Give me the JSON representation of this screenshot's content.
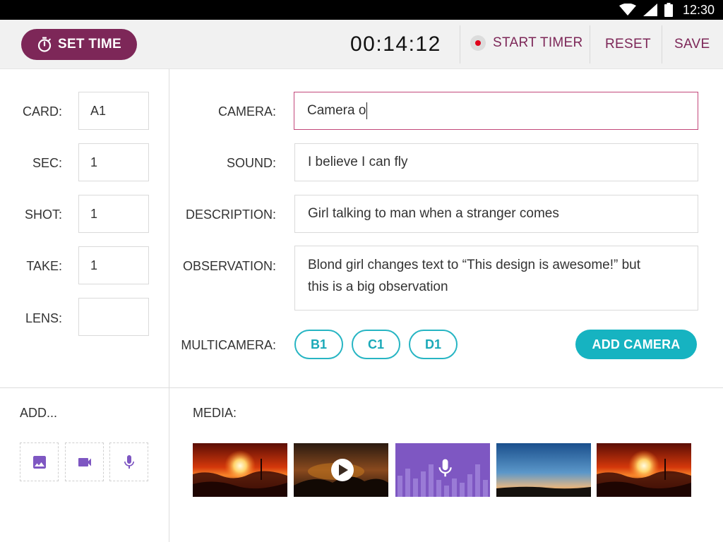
{
  "status_bar": {
    "time": "12:30"
  },
  "toolbar": {
    "set_time_label": "SET TIME",
    "timer": "00:14:12",
    "start_timer_label": "START TIMER",
    "reset_label": "RESET",
    "save_label": "SAVE"
  },
  "left_form": {
    "card_label": "CARD:",
    "card_value": "A1",
    "sec_label": "SEC:",
    "sec_value": "1",
    "shot_label": "SHOT:",
    "shot_value": "1",
    "take_label": "TAKE:",
    "take_value": "1",
    "lens_label": "LENS:",
    "lens_value": ""
  },
  "right_form": {
    "camera_label": "CAMERA:",
    "camera_value": "Camera o",
    "sound_label": "SOUND:",
    "sound_value": "I believe I can fly",
    "description_label": "DESCRIPTION:",
    "description_value": "Girl talking to man when a stranger comes",
    "observation_label": "OBSERVATION:",
    "observation_line1": "Blond girl changes text to “This design is awesome!” but",
    "observation_line2": "this is a big observation",
    "multicamera_label": "MULTICAMERA:",
    "chips": [
      "B1",
      "C1",
      "D1"
    ],
    "add_camera_label": "ADD CAMERA"
  },
  "bottom": {
    "add_label": "ADD...",
    "media_label": "MEDIA:"
  },
  "colors": {
    "brand": "#7d2758",
    "accent": "#16b3c1",
    "focus_border": "#c2477a",
    "icon_purple": "#7e57c2",
    "record_red": "#e0001a"
  },
  "icons": {
    "set_time": "stopwatch-icon",
    "add": [
      "image-icon",
      "videocam-icon",
      "mic-icon"
    ],
    "media_overlay": [
      "play-icon",
      "mic-icon"
    ]
  }
}
